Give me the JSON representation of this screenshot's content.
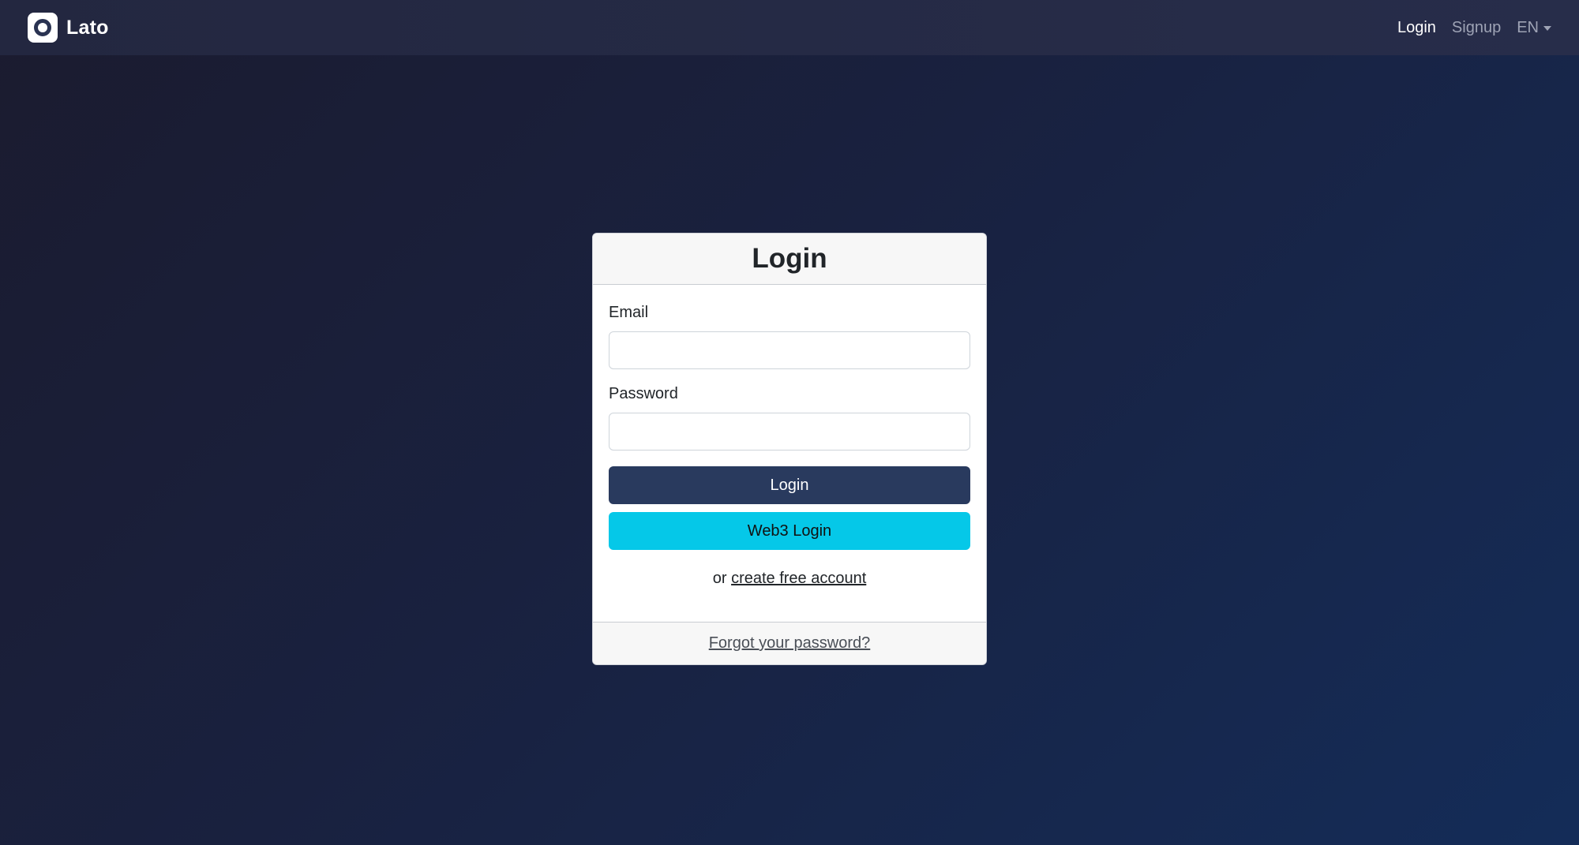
{
  "colors": {
    "accent_primary": "#293a5e",
    "accent_web3": "#05c8e8",
    "navbar_bg": "#252a45",
    "page_bg_start": "#1b1b2f",
    "page_bg_end": "#142c58"
  },
  "navbar": {
    "brand_icon": "lato-logo-icon",
    "brand_name": "Lato",
    "links": {
      "login": "Login",
      "signup": "Signup"
    },
    "language": {
      "selected": "EN",
      "icon": "caret-down-icon"
    }
  },
  "login_card": {
    "title": "Login",
    "email": {
      "label": "Email",
      "value": "",
      "placeholder": ""
    },
    "password": {
      "label": "Password",
      "value": "",
      "placeholder": ""
    },
    "login_button": "Login",
    "web3_button": "Web3 Login",
    "alt_prefix": "or",
    "alt_link": "create free account",
    "forgot_link": "Forgot your password?"
  }
}
